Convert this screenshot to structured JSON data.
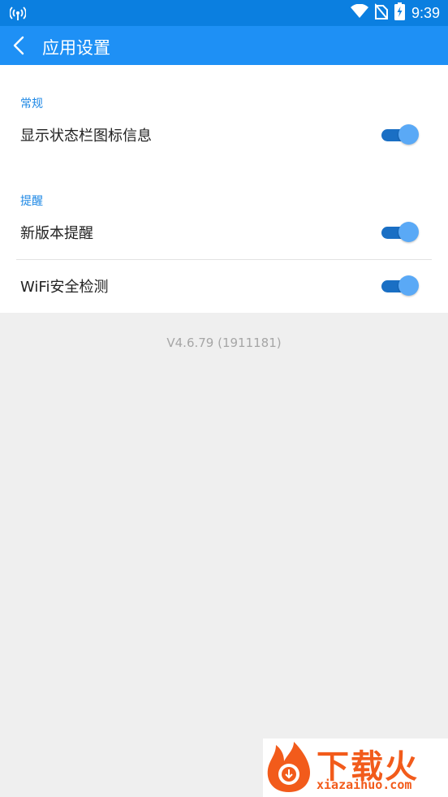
{
  "status_bar": {
    "time": "9:39",
    "icons": [
      "hotspot-icon",
      "wifi-icon",
      "no-sim-icon",
      "battery-charging-icon"
    ]
  },
  "app_bar": {
    "back_icon": "chevron-left-icon",
    "title": "应用设置"
  },
  "sections": [
    {
      "header": "常规",
      "items": [
        {
          "label": "显示状态栏图标信息",
          "enabled": true
        }
      ]
    },
    {
      "header": "提醒",
      "items": [
        {
          "label": "新版本提醒",
          "enabled": true
        },
        {
          "label": "WiFi安全检测",
          "enabled": true
        }
      ]
    }
  ],
  "version": "V4.6.79 (1911181)",
  "watermark": {
    "brand": "下载火",
    "domain": "xiazaihuo.com"
  },
  "colors": {
    "status_bar": "#0b7fe0",
    "app_bar": "#1e90f5",
    "accent": "#1e88e5",
    "toggle_track": "#1a6fc4",
    "toggle_thumb": "#5aa9f6",
    "watermark": "#f25b1b"
  }
}
